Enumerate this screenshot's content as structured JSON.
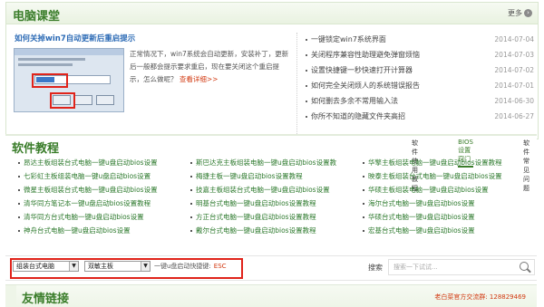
{
  "classroom": {
    "title": "电脑课堂",
    "more_label": "更多",
    "feature": {
      "title": "如何关掉win7自动更新后重启提示",
      "description": "正常情况下，win7系统会自动更新，安装补丁，更新后一般都会提示要求重启，现在要关闭这个重启提示，怎么做呢？",
      "read_more": "查看详细>>"
    },
    "news": [
      {
        "title": "一键锁定win7系统界面",
        "date": "2014-07-04"
      },
      {
        "title": "关闭程序兼容性助理避免弹窗烦恼",
        "date": "2014-07-03"
      },
      {
        "title": "设置快捷键一秒快速打开计算器",
        "date": "2014-07-02"
      },
      {
        "title": "如何完全关闭烦人的系统错误报告",
        "date": "2014-07-01"
      },
      {
        "title": "如何删去多余不常用输入法",
        "date": "2014-06-30"
      },
      {
        "title": "你所不知道的隐藏文件夹高招",
        "date": "2014-06-27"
      }
    ]
  },
  "software": {
    "title": "软件教程",
    "tabs": [
      "软件使用教程",
      "BIOS设置窍门",
      "软件常见问题"
    ],
    "active_tab": 1,
    "items": [
      [
        "昂达主板组装台式电脑一键u盘启动bios设置",
        "斯巴达克主板组装电脑一键u盘启动bios设置教",
        "华擎主板组装电脑一键u盘启动bios设置教程"
      ],
      [
        "七彩虹主板组装电脑一键u盘启动bios设置",
        "梅捷主板一键u盘启动bios设置教程",
        "映泰主板组装台式电脑一键u盘启动bios设置"
      ],
      [
        "微星主板组装台式电脑一键u盘启动bios设置",
        "技嘉主板组装台式电脑一键u盘启动bios设置",
        "华硕主板组装电脑一键u盘启动bios设置"
      ],
      [
        "清华同方笔记本一键u盘启动bios设置教程",
        "明基台式电脑一键u盘启动bios设置教程",
        "海尔台式电脑一键u盘启动bios设置"
      ],
      [
        "清华同方台式电脑一键u盘启动bios设置",
        "方正台式电脑一键u盘启动bios设置教程",
        "华硕台式电脑一键u盘启动bios设置"
      ],
      [
        "神舟台式电脑一键u盘启动bios设置",
        "戴尔台式电脑一键u盘启动bios设置教程",
        "宏基台式电脑一键u盘启动bios设置"
      ]
    ]
  },
  "searchbar": {
    "select1": "组装台式电脑",
    "select2": "双敏主板",
    "hint": "一键u盘启动快捷键:",
    "hotkey": "ESC",
    "search_label": "搜索",
    "search_placeholder": "搜索一下试试..."
  },
  "links": {
    "title": "友情链接",
    "contact": "老白菜官方交流群: 128829469"
  },
  "colors": {
    "accent_green": "#3a7d2a",
    "link_green": "#2d7a2d",
    "highlight_red": "#e0231a",
    "title_blue": "#2b6ab5"
  }
}
